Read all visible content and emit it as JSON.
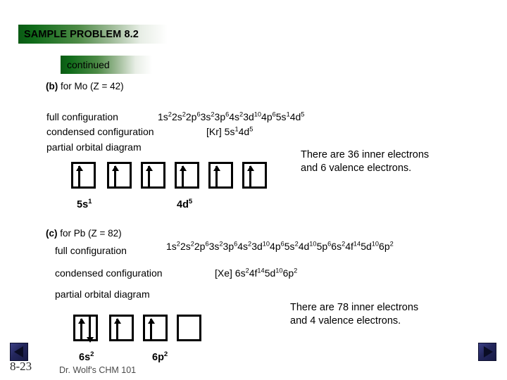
{
  "slide": {
    "title_banner": "SAMPLE PROBLEM 8.2",
    "continued_banner": "continued"
  },
  "part_b": {
    "tag": "(b)",
    "heading_rest": " for Mo (Z = 42)",
    "full_config_label": "full configuration",
    "full_config_value": "1s22s22p63s23p64s23d104p65s14d5",
    "full_config_value_html": "1s<sup>2</sup>2s<sup>2</sup>2p<sup>6</sup>3s<sup>2</sup>3p<sup>6</sup>4s<sup>2</sup>3d<sup>10</sup>4p<sup>6</sup>5s<sup>1</sup>4d<sup>5</sup>",
    "condensed_config_label": "condensed configuration",
    "condensed_config_value": "[Kr] 5s14d5",
    "condensed_config_value_html": "[Kr] 5s<sup>1</sup>4d<sup>5</sup>",
    "partial_orbital_label": "partial orbital diagram",
    "note_line_1": "There are 36 inner electrons",
    "note_line_2": "and 6 valence electrons.",
    "orbital_caption_left": "5s1",
    "orbital_caption_left_html": "5s<sup>1</sup>",
    "orbital_caption_right": "4d5",
    "orbital_caption_right_html": "4d<sup>5</sup>",
    "orbitals": [
      {
        "name": "5s-orbital-box",
        "up": true,
        "down": false
      },
      {
        "name": "4d-orbital-box-1",
        "up": true,
        "down": false
      },
      {
        "name": "4d-orbital-box-2",
        "up": true,
        "down": false
      },
      {
        "name": "4d-orbital-box-3",
        "up": true,
        "down": false
      },
      {
        "name": "4d-orbital-box-4",
        "up": true,
        "down": false
      },
      {
        "name": "4d-orbital-box-5",
        "up": true,
        "down": false
      }
    ]
  },
  "part_c": {
    "tag": "(c)",
    "heading_rest": " for Pb (Z = 82)",
    "full_config_label": "full configuration",
    "full_config_value": "1s22s22p63s23p64s23d104p65s24d105p66s24f145d106p2",
    "full_config_value_html": "1s<sup>2</sup>2s<sup>2</sup>2p<sup>6</sup>3s<sup>2</sup>3p<sup>6</sup>4s<sup>2</sup>3d<sup>10</sup>4p<sup>6</sup>5s<sup>2</sup>4d<sup>10</sup>5p<sup>6</sup>6s<sup>2</sup>4f<sup>14</sup>5d<sup>10</sup>6p<sup>2</sup>",
    "condensed_config_label": "condensed configuration",
    "condensed_config_value": "[Xe] 6s24f145d106p2",
    "condensed_config_value_html": "[Xe] 6s<sup>2</sup>4f<sup>14</sup>5d<sup>10</sup>6p<sup>2</sup>",
    "partial_orbital_label": "partial orbital diagram",
    "note_line_1": "There are 78 inner electrons",
    "note_line_2": "and 4 valence electrons.",
    "orbital_caption_left": "6s2",
    "orbital_caption_left_html": "6s<sup>2</sup>",
    "orbital_caption_right": "6p2",
    "orbital_caption_right_html": "6p<sup>2</sup>",
    "orbitals": [
      {
        "name": "6s-orbital-box",
        "up": true,
        "down": true
      },
      {
        "name": "6p-orbital-box-1",
        "up": true,
        "down": false
      },
      {
        "name": "6p-orbital-box-2",
        "up": true,
        "down": false
      },
      {
        "name": "6p-orbital-box-3",
        "up": false,
        "down": false
      }
    ]
  },
  "footer": {
    "page_number": "8-23",
    "credit": "Dr. Wolf's CHM 101",
    "prev_label": "previous slide",
    "next_label": "next slide"
  },
  "colors": {
    "banner_green": "#0a5a14",
    "nav_button_blue": "#23265c",
    "text": "#000000"
  }
}
